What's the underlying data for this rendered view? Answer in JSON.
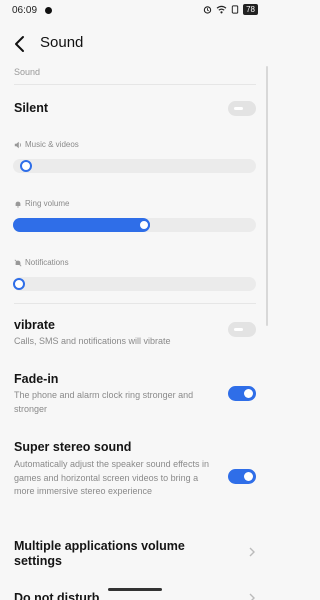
{
  "status_bar": {
    "time": "06:09",
    "battery": "78",
    "icons": [
      "alarm-icon",
      "wifi-icon",
      "battery-icon"
    ]
  },
  "header": {
    "title": "Sound",
    "back_icon": "chevron-left-icon"
  },
  "section_label": "Sound",
  "silent": {
    "title": "Silent",
    "enabled": false
  },
  "sliders": {
    "media": {
      "label": "Music & videos",
      "icon": "speaker-icon",
      "level": 0.03
    },
    "ring": {
      "label": "Ring volume",
      "icon": "bell-icon",
      "level": 0.54
    },
    "notifications": {
      "label": "Notifications",
      "icon": "bell-muted-icon",
      "level": 0.0
    }
  },
  "vibrate": {
    "title": "vibrate",
    "description": "Calls, SMS and notifications will vibrate",
    "enabled": false
  },
  "fade_in": {
    "title": "Fade-in",
    "description": "The phone and alarm clock ring stronger and stronger",
    "enabled": true
  },
  "super_stereo": {
    "title": "Super stereo sound",
    "description": "Automatically adjust the speaker sound effects in games and horizontal screen videos to bring a more immersive stereo experience",
    "enabled": true
  },
  "multi_app_volume": {
    "title": "Multiple applications volume settings"
  },
  "do_not_disturb": {
    "title": "Do not disturb"
  },
  "colors": {
    "accent": "#2f6ee8",
    "track": "#ebebeb",
    "background": "#f7f7f7"
  }
}
